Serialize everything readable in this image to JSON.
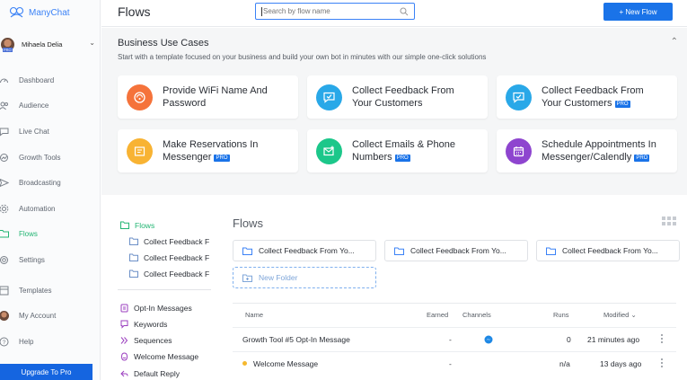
{
  "app": {
    "brand": "ManyChat",
    "page_title": "Flows"
  },
  "user": {
    "name": "Mihaela Delia",
    "plan_badge": "PRO"
  },
  "sidebar": {
    "items": [
      {
        "key": "dashboard",
        "label": "Dashboard",
        "icon": "dashboard-icon"
      },
      {
        "key": "audience",
        "label": "Audience",
        "icon": "audience-icon"
      },
      {
        "key": "live-chat",
        "label": "Live Chat",
        "icon": "chat-icon"
      },
      {
        "key": "growth-tools",
        "label": "Growth Tools",
        "icon": "growth-icon"
      },
      {
        "key": "broadcasting",
        "label": "Broadcasting",
        "icon": "send-icon"
      },
      {
        "key": "automation",
        "label": "Automation",
        "icon": "gear-icon"
      },
      {
        "key": "flows",
        "label": "Flows",
        "icon": "folder-icon",
        "active": true
      },
      {
        "key": "settings",
        "label": "Settings",
        "icon": "settings-icon"
      },
      {
        "key": "templates",
        "label": "Templates",
        "icon": "templates-icon"
      },
      {
        "key": "my-account",
        "label": "My Account",
        "icon": "avatar"
      },
      {
        "key": "help",
        "label": "Help",
        "icon": "help-icon"
      }
    ],
    "upgrade_label": "Upgrade To Pro"
  },
  "search": {
    "placeholder": "Search by flow name"
  },
  "new_flow_label": "+ New Flow",
  "business": {
    "title": "Business Use Cases",
    "subtitle": "Start with a template focused on your business and build your own bot in minutes with our simple one-click solutions",
    "cards": [
      {
        "line1": "Provide WiFi Name And",
        "line2": "Password",
        "pro": false,
        "icon": "wifi-icon",
        "color": "#f5733b"
      },
      {
        "line1": "Collect Feedback From",
        "line2": "Your Customers",
        "pro": false,
        "icon": "feedback-icon",
        "color": "#29a8e8"
      },
      {
        "line1": "Collect Feedback From",
        "line2": "Your Customers",
        "pro": true,
        "icon": "feedback-icon",
        "color": "#29a8e8"
      },
      {
        "line1": "Make Reservations In",
        "line2": "Messenger",
        "pro": true,
        "icon": "reservation-icon",
        "color": "#f8b333"
      },
      {
        "line1": "Collect Emails & Phone",
        "line2": "Numbers",
        "pro": true,
        "icon": "email-icon",
        "color": "#1cc78a"
      },
      {
        "line1": "Schedule Appointments In",
        "line2": "Messenger/Calendly",
        "pro": true,
        "icon": "calendar-icon",
        "color": "#8e45cf"
      }
    ],
    "pro_label": "PRO"
  },
  "folder_tree": {
    "root": "Flows",
    "children": [
      "Collect Feedback F",
      "Collect Feedback F",
      "Collect Feedback F"
    ],
    "sections": [
      {
        "label": "Opt-In Messages",
        "icon": "optin-icon"
      },
      {
        "label": "Keywords",
        "icon": "keywords-icon"
      },
      {
        "label": "Sequences",
        "icon": "sequences-icon"
      },
      {
        "label": "Welcome Message",
        "icon": "welcome-icon"
      },
      {
        "label": "Default Reply",
        "icon": "reply-icon"
      }
    ]
  },
  "flows_panel": {
    "title": "Flows",
    "folders": [
      "Collect Feedback From Yo...",
      "Collect Feedback From Yo...",
      "Collect Feedback From Yo..."
    ],
    "new_folder_label": "New Folder",
    "table": {
      "headers": {
        "name": "Name",
        "earned": "Earned",
        "channels": "Channels",
        "runs": "Runs",
        "modified": "Modified"
      },
      "rows": [
        {
          "name": "Growth Tool #5 Opt-In Message",
          "earned": "-",
          "channel_icon": "messenger-icon",
          "runs": "0",
          "modified": "21 minutes ago",
          "status_dot": false
        },
        {
          "name": "Welcome Message",
          "earned": "-",
          "channel_icon": "",
          "runs": "n/a",
          "modified": "13 days ago",
          "status_dot": true
        }
      ]
    }
  }
}
